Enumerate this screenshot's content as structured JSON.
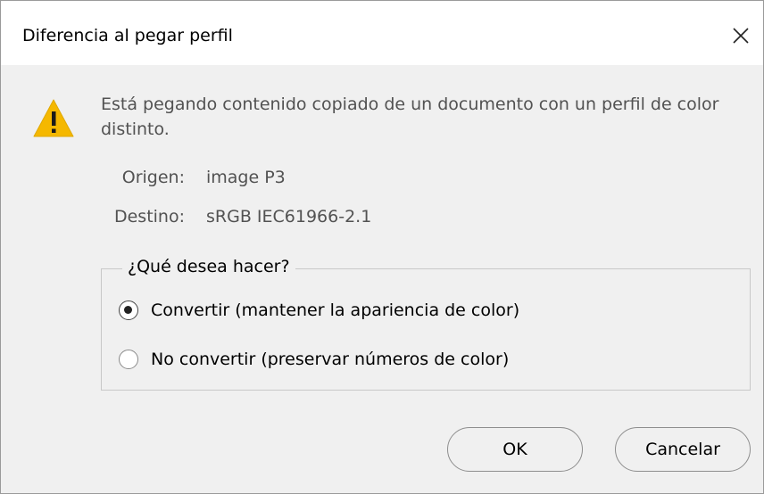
{
  "dialog": {
    "title": "Diferencia al pegar perfil",
    "close_icon": "close-icon",
    "warning_icon": "warning-triangle-icon",
    "message": "Está pegando contenido copiado de un documento con un perfil de color distinto.",
    "origin": {
      "label": "Origen:",
      "value": "image P3"
    },
    "destination": {
      "label": "Destino:",
      "value": "sRGB IEC61966-2.1"
    },
    "group": {
      "legend": "¿Qué desea hacer?",
      "options": [
        {
          "label": "Convertir (mantener la apariencia de color)",
          "selected": true
        },
        {
          "label": "No convertir (preservar números de color)",
          "selected": false
        }
      ]
    },
    "buttons": {
      "ok": "OK",
      "cancel": "Cancelar"
    },
    "colors": {
      "warning_yellow": "#f5b800",
      "secondary_text": "#525252",
      "background": "#f0f0f0"
    }
  }
}
